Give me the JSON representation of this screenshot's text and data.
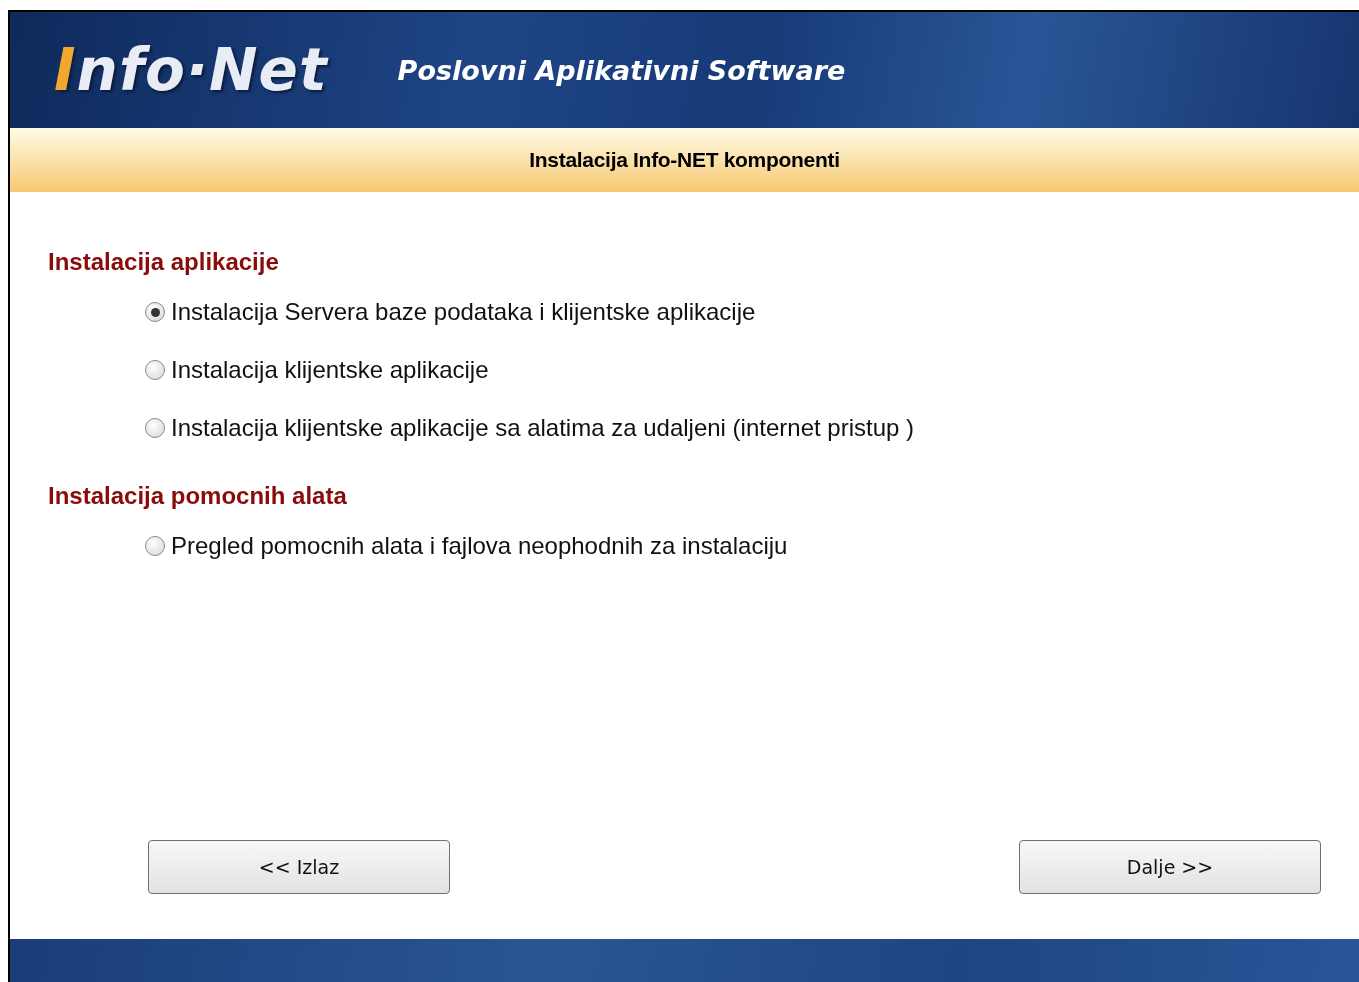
{
  "header": {
    "logo": {
      "initial": "I",
      "rest": "nfo·Net"
    },
    "tagline": "Poslovni  Aplikativni Software"
  },
  "banner": {
    "title": "Instalacija Info-NET komponenti"
  },
  "sections": [
    {
      "title": "Instalacija aplikacije",
      "options": [
        {
          "label": "Instalacija Servera baze podataka i  klijentske aplikacije",
          "selected": true
        },
        {
          "label": "Instalacija klijentske aplikacije",
          "selected": false
        },
        {
          "label": "Instalacija klijentske aplikacije sa alatima za udaljeni (internet pristup )",
          "selected": false
        }
      ]
    },
    {
      "title": "Instalacija pomocnih alata",
      "options": [
        {
          "label": "Pregled pomocnih alata i fajlova neophodnih za instalaciju",
          "selected": false
        }
      ]
    }
  ],
  "buttons": [
    {
      "label": "<< Izlaz"
    },
    {
      "label": "Dalje >>"
    }
  ]
}
